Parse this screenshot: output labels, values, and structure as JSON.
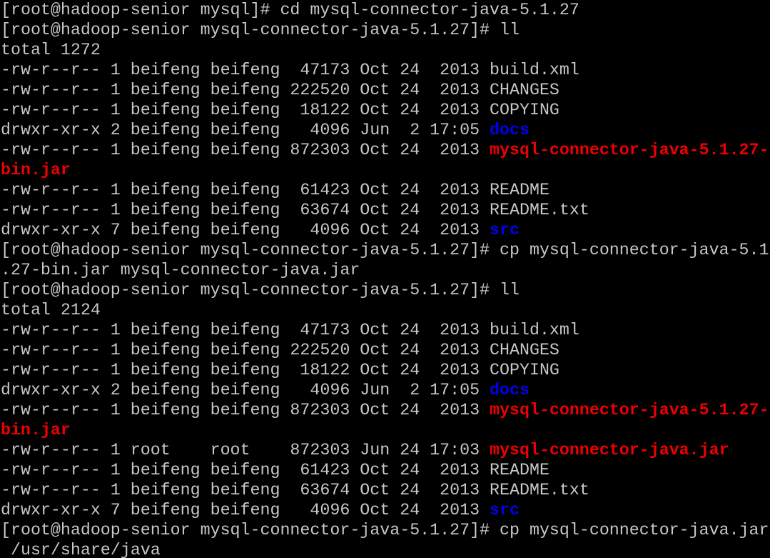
{
  "colors": {
    "background": "#000000",
    "text": "#c7c7c7",
    "directory": "#0000ee",
    "archive": "#ee0000"
  },
  "lines": [
    [
      {
        "text": "[root@hadoop-senior mysql]# cd mysql-connector-java-5.1.27",
        "style": "plain"
      }
    ],
    [
      {
        "text": "[root@hadoop-senior mysql-connector-java-5.1.27]# ll",
        "style": "plain"
      }
    ],
    [
      {
        "text": "total 1272",
        "style": "plain"
      }
    ],
    [
      {
        "text": "-rw-r--r-- 1 beifeng beifeng  47173 Oct 24  2013 build.xml",
        "style": "plain"
      }
    ],
    [
      {
        "text": "-rw-r--r-- 1 beifeng beifeng 222520 Oct 24  2013 CHANGES",
        "style": "plain"
      }
    ],
    [
      {
        "text": "-rw-r--r-- 1 beifeng beifeng  18122 Oct 24  2013 COPYING",
        "style": "plain"
      }
    ],
    [
      {
        "text": "drwxr-xr-x 2 beifeng beifeng   4096 Jun  2 17:05 ",
        "style": "plain"
      },
      {
        "text": "docs",
        "style": "dir"
      }
    ],
    [
      {
        "text": "-rw-r--r-- 1 beifeng beifeng 872303 Oct 24  2013 ",
        "style": "plain"
      },
      {
        "text": "mysql-connector-java-5.1.27-",
        "style": "jar"
      }
    ],
    [
      {
        "text": "bin.jar",
        "style": "jar"
      }
    ],
    [
      {
        "text": "-rw-r--r-- 1 beifeng beifeng  61423 Oct 24  2013 README",
        "style": "plain"
      }
    ],
    [
      {
        "text": "-rw-r--r-- 1 beifeng beifeng  63674 Oct 24  2013 README.txt",
        "style": "plain"
      }
    ],
    [
      {
        "text": "drwxr-xr-x 7 beifeng beifeng   4096 Oct 24  2013 ",
        "style": "plain"
      },
      {
        "text": "src",
        "style": "dir"
      }
    ],
    [
      {
        "text": "[root@hadoop-senior mysql-connector-java-5.1.27]# cp mysql-connector-java-5.1",
        "style": "plain"
      }
    ],
    [
      {
        "text": ".27-bin.jar mysql-connector-java.jar",
        "style": "plain"
      }
    ],
    [
      {
        "text": "[root@hadoop-senior mysql-connector-java-5.1.27]# ll",
        "style": "plain"
      }
    ],
    [
      {
        "text": "total 2124",
        "style": "plain"
      }
    ],
    [
      {
        "text": "-rw-r--r-- 1 beifeng beifeng  47173 Oct 24  2013 build.xml",
        "style": "plain"
      }
    ],
    [
      {
        "text": "-rw-r--r-- 1 beifeng beifeng 222520 Oct 24  2013 CHANGES",
        "style": "plain"
      }
    ],
    [
      {
        "text": "-rw-r--r-- 1 beifeng beifeng  18122 Oct 24  2013 COPYING",
        "style": "plain"
      }
    ],
    [
      {
        "text": "drwxr-xr-x 2 beifeng beifeng   4096 Jun  2 17:05 ",
        "style": "plain"
      },
      {
        "text": "docs",
        "style": "dir"
      }
    ],
    [
      {
        "text": "-rw-r--r-- 1 beifeng beifeng 872303 Oct 24  2013 ",
        "style": "plain"
      },
      {
        "text": "mysql-connector-java-5.1.27-",
        "style": "jar"
      }
    ],
    [
      {
        "text": "bin.jar",
        "style": "jar"
      }
    ],
    [
      {
        "text": "-rw-r--r-- 1 root    root    872303 Jun 24 17:03 ",
        "style": "plain"
      },
      {
        "text": "mysql-connector-java.jar",
        "style": "jar"
      }
    ],
    [
      {
        "text": "-rw-r--r-- 1 beifeng beifeng  61423 Oct 24  2013 README",
        "style": "plain"
      }
    ],
    [
      {
        "text": "-rw-r--r-- 1 beifeng beifeng  63674 Oct 24  2013 README.txt",
        "style": "plain"
      }
    ],
    [
      {
        "text": "drwxr-xr-x 7 beifeng beifeng   4096 Oct 24  2013 ",
        "style": "plain"
      },
      {
        "text": "src",
        "style": "dir"
      }
    ],
    [
      {
        "text": "[root@hadoop-senior mysql-connector-java-5.1.27]# cp mysql-connector-java.jar",
        "style": "plain"
      }
    ],
    [
      {
        "text": " /usr/share/java",
        "style": "plain"
      }
    ]
  ]
}
